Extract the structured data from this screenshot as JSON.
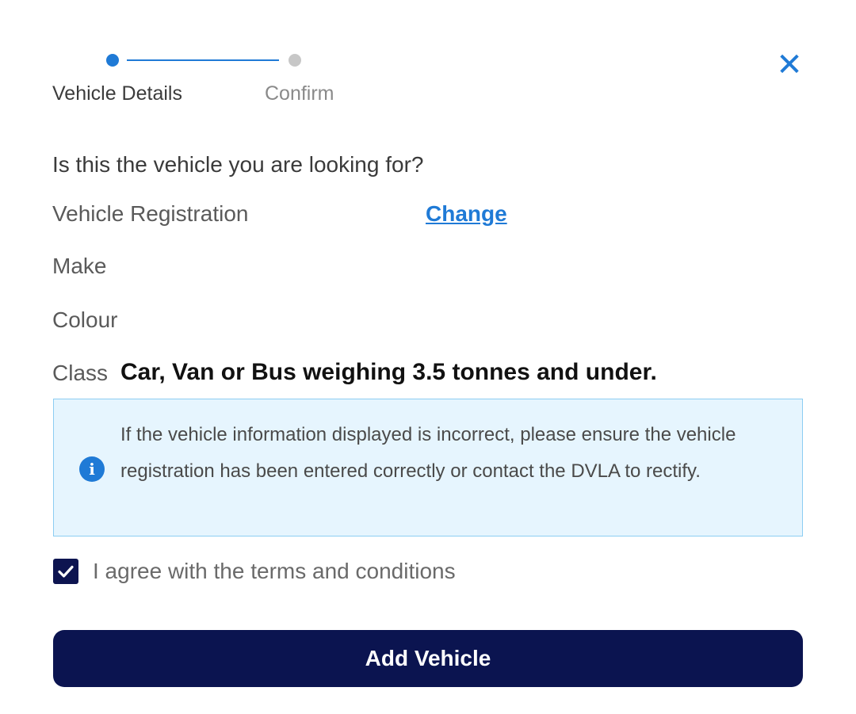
{
  "stepper": {
    "steps": [
      {
        "label": "Vehicle Details",
        "state": "active"
      },
      {
        "label": "Confirm",
        "state": "inactive"
      }
    ]
  },
  "close": {
    "icon": "close-icon",
    "glyph": "✕"
  },
  "question": "Is this the vehicle you are looking for?",
  "vehicle": {
    "registration_label": "Vehicle Registration",
    "change_label": "Change",
    "make_label": "Make",
    "colour_label": "Colour",
    "class_label": "Class",
    "class_value": "Car, Van or Bus weighing 3.5 tonnes and under."
  },
  "info": {
    "icon": "info-icon",
    "glyph": "i",
    "text": "If the vehicle information displayed is incorrect, please ensure the vehicle registration has been entered correctly or contact the DVLA to rectify."
  },
  "terms": {
    "checked": true,
    "label": "I agree with the terms and conditions"
  },
  "action": {
    "label": "Add Vehicle"
  },
  "colors": {
    "accent": "#1f7ad6",
    "primary_button": "#0b1450",
    "info_background": "#e6f5fe",
    "info_border": "#8ccdf2"
  }
}
